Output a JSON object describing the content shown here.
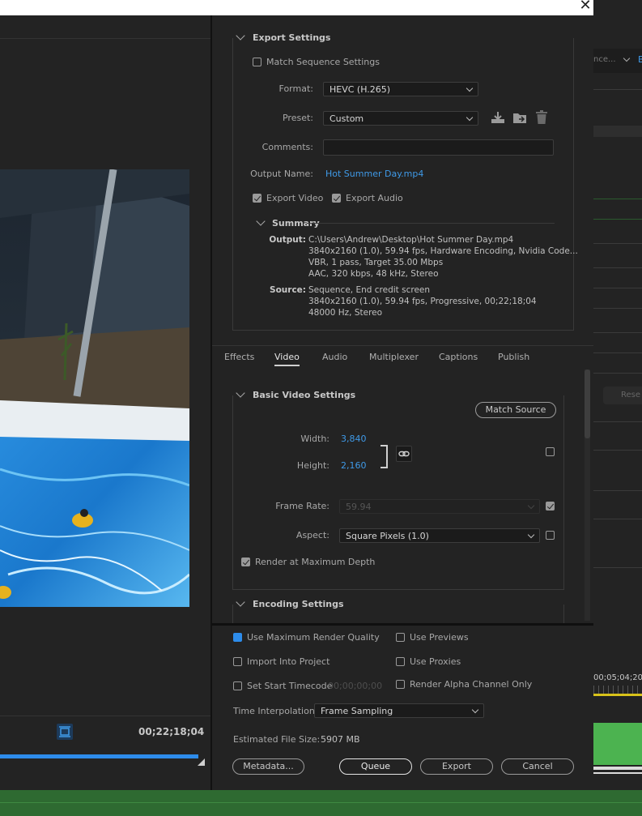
{
  "export_settings": {
    "header": "Export Settings",
    "match_sequence_label": "Match Sequence Settings",
    "format_label": "Format:",
    "format_value": "HEVC (H.265)",
    "preset_label": "Preset:",
    "preset_value": "Custom",
    "comments_label": "Comments:",
    "comments_value": "",
    "output_name_label": "Output Name:",
    "output_name_value": "Hot Summer Day.mp4",
    "export_video_label": "Export Video",
    "export_audio_label": "Export Audio"
  },
  "summary": {
    "header": "Summary",
    "output_label": "Output:",
    "output_lines": [
      "C:\\Users\\Andrew\\Desktop\\Hot Summer Day.mp4",
      "3840x2160 (1.0), 59.94 fps, Hardware Encoding, Nvidia Code...",
      "VBR, 1 pass, Target 35.00 Mbps",
      "AAC, 320 kbps, 48 kHz, Stereo"
    ],
    "source_label": "Source:",
    "source_lines": [
      "Sequence, End credit screen",
      "3840x2160 (1.0), 59.94 fps, Progressive, 00;22;18;04",
      "48000 Hz, Stereo"
    ]
  },
  "tabs": [
    "Effects",
    "Video",
    "Audio",
    "Multiplexer",
    "Captions",
    "Publish"
  ],
  "active_tab": "Video",
  "basic_video": {
    "header": "Basic Video Settings",
    "match_source_label": "Match Source",
    "width_label": "Width:",
    "width_value": "3,840",
    "height_label": "Height:",
    "height_value": "2,160",
    "frame_rate_label": "Frame Rate:",
    "frame_rate_value": "59.94",
    "aspect_label": "Aspect:",
    "aspect_value": "Square Pixels (1.0)",
    "render_max_depth_label": "Render at Maximum Depth"
  },
  "encoding": {
    "header": "Encoding Settings"
  },
  "bottom": {
    "use_max_render_quality": "Use Maximum Render Quality",
    "use_previews": "Use Previews",
    "import_into_project": "Import Into Project",
    "use_proxies": "Use Proxies",
    "set_start_timecode": "Set Start Timecode",
    "start_timecode_value": "00;00;00;00",
    "render_alpha_only": "Render Alpha Channel Only",
    "time_interpolation_label": "Time Interpolation:",
    "time_interpolation_value": "Frame Sampling",
    "estimated_size_label": "Estimated File Size:",
    "estimated_size_value": "5907 MB",
    "metadata_button": "Metadata...",
    "queue_button": "Queue",
    "export_button": "Export",
    "cancel_button": "Cancel"
  },
  "preview": {
    "timecode": "00;22;18;04"
  },
  "background_app": {
    "timeline_timecode": "00;05;04;20",
    "partial_label_1": "nce...",
    "partial_label_2": "B",
    "partial_label_3": "Rese"
  },
  "colors": {
    "accent_blue": "#2d8ceb",
    "link_blue": "#3f9ae8",
    "panel_bg": "#232323",
    "timeline_green": "#4cb350"
  }
}
